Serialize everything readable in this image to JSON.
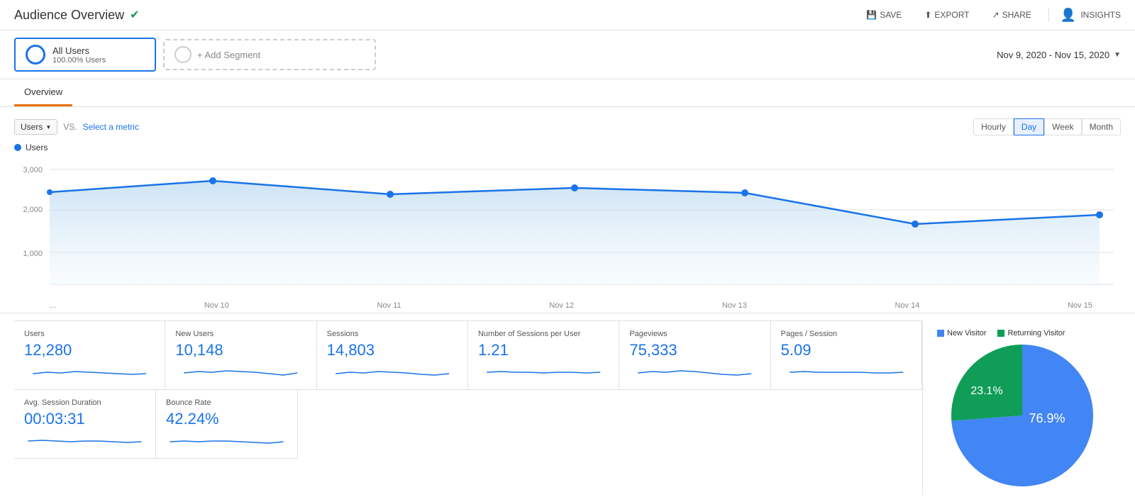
{
  "header": {
    "title": "Audience Overview",
    "verified": true,
    "actions": {
      "save": "SAVE",
      "export": "EXPORT",
      "share": "SHARE",
      "insights": "INSIGHTS"
    }
  },
  "date_range": "Nov 9, 2020 - Nov 15, 2020",
  "segments": [
    {
      "name": "All Users",
      "sub": "100.00% Users"
    }
  ],
  "add_segment_label": "+ Add Segment",
  "tabs": [
    "Overview"
  ],
  "chart": {
    "metric_select": "Users",
    "vs_label": "VS.",
    "select_metric_label": "Select a metric",
    "legend_label": "Users",
    "time_buttons": [
      "Hourly",
      "Day",
      "Week",
      "Month"
    ],
    "active_time": "Day",
    "y_labels": [
      "3,000",
      "2,000",
      "1,000"
    ],
    "x_labels": [
      "...",
      "Nov 10",
      "Nov 11",
      "Nov 12",
      "Nov 13",
      "Nov 14",
      "Nov 15"
    ]
  },
  "metrics": [
    {
      "label": "Users",
      "value": "12,280"
    },
    {
      "label": "New Users",
      "value": "10,148"
    },
    {
      "label": "Sessions",
      "value": "14,803"
    },
    {
      "label": "Number of Sessions per User",
      "value": "1.21"
    },
    {
      "label": "Pageviews",
      "value": "75,333"
    },
    {
      "label": "Pages / Session",
      "value": "5.09"
    }
  ],
  "metrics_row2": [
    {
      "label": "Avg. Session Duration",
      "value": "00:03:31"
    },
    {
      "label": "Bounce Rate",
      "value": "42.24%"
    }
  ],
  "pie": {
    "new_visitor_label": "New Visitor",
    "returning_visitor_label": "Returning Visitor",
    "new_pct": 76.9,
    "returning_pct": 23.1,
    "new_pct_label": "76.9%",
    "returning_pct_label": "23.1%",
    "new_color": "#4285f4",
    "returning_color": "#0f9d58"
  },
  "colors": {
    "blue": "#1a73e8",
    "chart_line": "#1a73e8",
    "chart_fill": "#d9e9f8",
    "green": "#0f9d58"
  }
}
